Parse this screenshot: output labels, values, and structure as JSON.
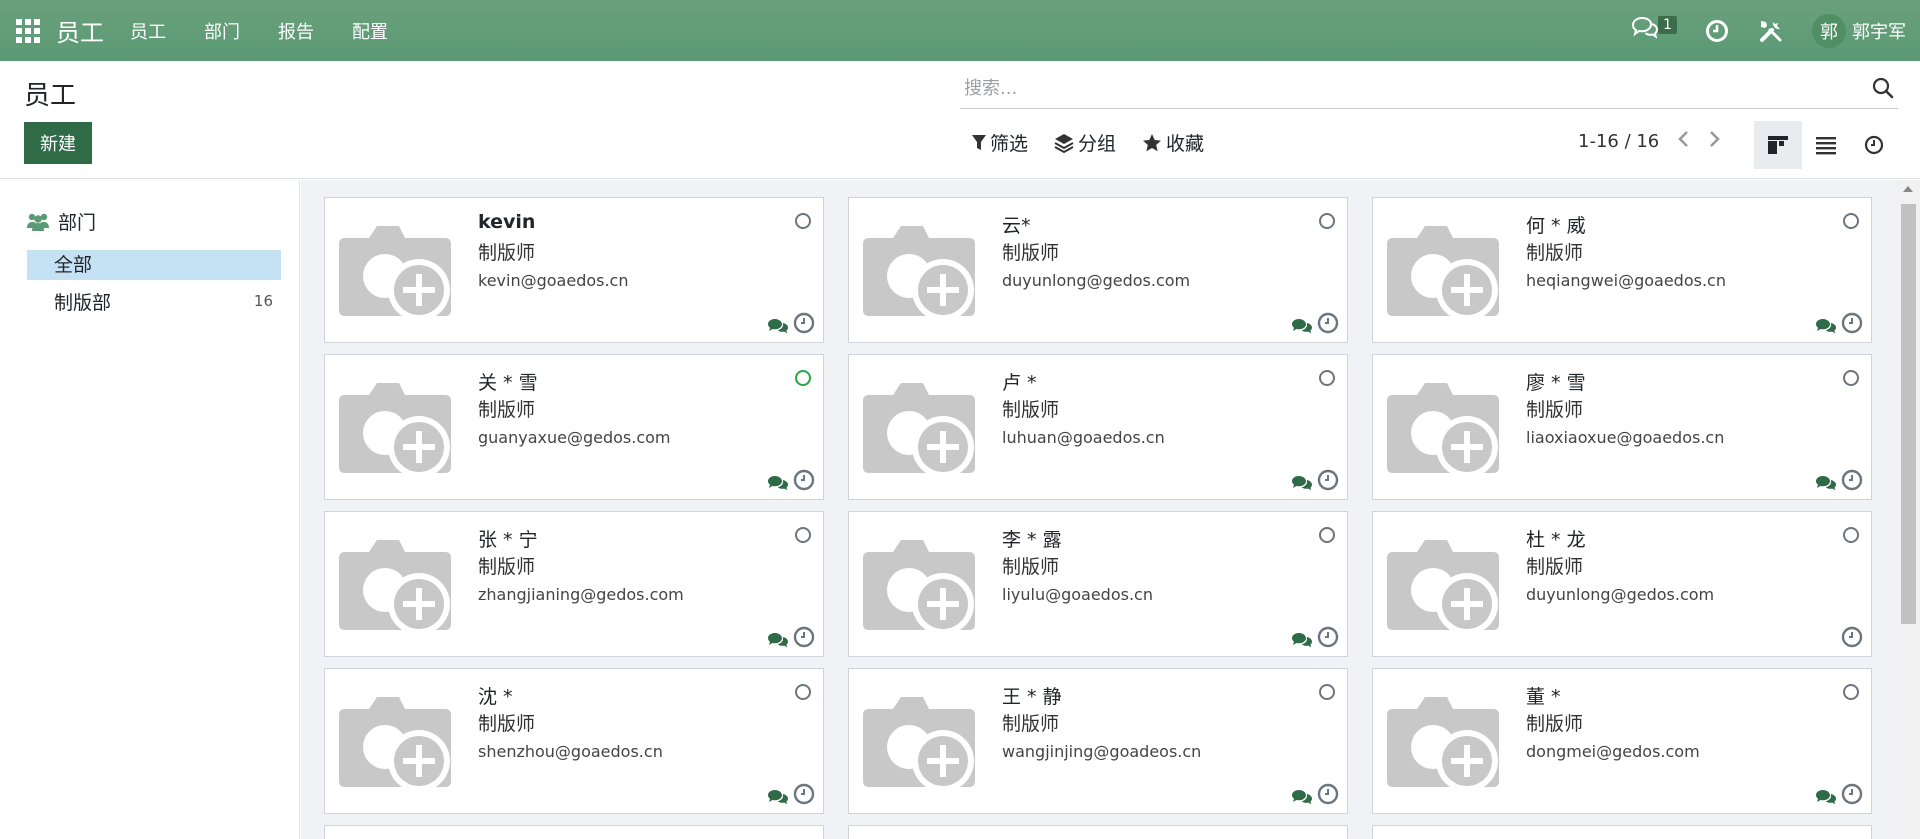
{
  "navbar": {
    "brand": "员工",
    "menu": [
      "员工",
      "部门",
      "报告",
      "配置"
    ],
    "chat_count": "1",
    "user_initial": "郭",
    "user_name": "郭宇军"
  },
  "control": {
    "title": "员工",
    "new_button": "新建",
    "search_placeholder": "搜索...",
    "filter_label": "筛选",
    "group_label": "分组",
    "favorites_label": "收藏",
    "pager": "1-16 / 16"
  },
  "side": {
    "header": "部门",
    "all_label": "全部",
    "dept_name": "制版部",
    "dept_count": "16"
  },
  "employees": [
    {
      "name": "kevin",
      "job": "制版师",
      "email": "kevin@goaedos.cn",
      "online": false,
      "chat": true
    },
    {
      "name": "云*",
      "job": "制版师",
      "email": "duyunlong@gedos.com",
      "online": false,
      "chat": true
    },
    {
      "name": "何 * 威",
      "job": "制版师",
      "email": "heqiangwei@goaedos.cn",
      "online": false,
      "chat": true
    },
    {
      "name": "关 * 雪",
      "job": "制版师",
      "email": "guanyaxue@gedos.com",
      "online": true,
      "chat": true
    },
    {
      "name": "卢 *",
      "job": "制版师",
      "email": "luhuan@goaedos.cn",
      "online": false,
      "chat": true
    },
    {
      "name": "廖 * 雪",
      "job": "制版师",
      "email": "liaoxiaoxue@goaedos.cn",
      "online": false,
      "chat": true
    },
    {
      "name": "张 * 宁",
      "job": "制版师",
      "email": "zhangjianing@gedos.com",
      "online": false,
      "chat": true
    },
    {
      "name": "李 * 露",
      "job": "制版师",
      "email": "liyulu@goaedos.cn",
      "online": false,
      "chat": true
    },
    {
      "name": "杜 * 龙",
      "job": "制版师",
      "email": "duyunlong@gedos.com",
      "online": false,
      "chat": false
    },
    {
      "name": "沈 *",
      "job": "制版师",
      "email": "shenzhou@goaedos.cn",
      "online": false,
      "chat": true
    },
    {
      "name": "王 * 静",
      "job": "制版师",
      "email": "wangjinjing@goadeos.cn",
      "online": false,
      "chat": true
    },
    {
      "name": "董 *",
      "job": "制版师",
      "email": "dongmei@gedos.com",
      "online": false,
      "chat": true
    }
  ]
}
